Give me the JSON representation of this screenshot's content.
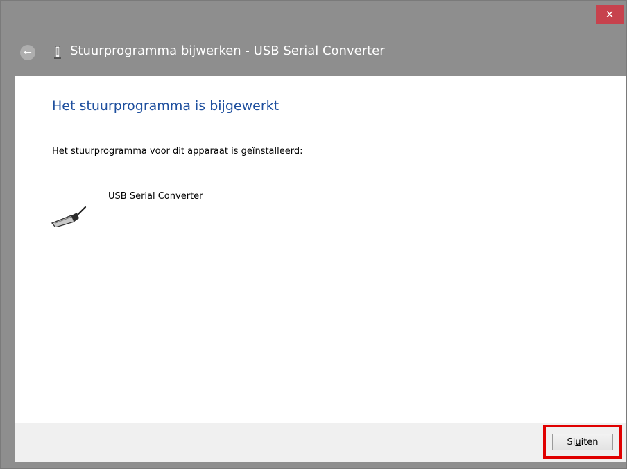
{
  "window": {
    "title": "Stuurprogramma bijwerken - USB Serial Converter",
    "close_symbol": "✕",
    "back_symbol": "←"
  },
  "content": {
    "heading": "Het stuurprogramma is bijgewerkt",
    "description": "Het stuurprogramma voor dit apparaat is geïnstalleerd:",
    "device_name": "USB Serial Converter",
    "device_icon": "usb-plug-icon"
  },
  "footer": {
    "close_button": {
      "label_pre": "Sl",
      "label_accel": "u",
      "label_post": "iten"
    }
  },
  "colors": {
    "title_bar": "#8e8e8e",
    "close_button": "#c7424d",
    "heading": "#1e4f9e",
    "highlight": "#e00000"
  }
}
